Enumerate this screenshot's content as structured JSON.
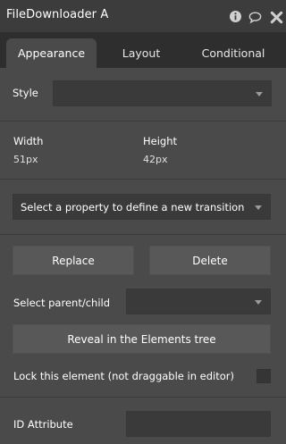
{
  "window": {
    "title": "FileDownloader A",
    "icons": [
      "info-icon",
      "comment-icon",
      "close-icon"
    ]
  },
  "tabs": [
    {
      "label": "Appearance",
      "active": true
    },
    {
      "label": "Layout",
      "active": false
    },
    {
      "label": "Conditional",
      "active": false
    }
  ],
  "style": {
    "label": "Style",
    "value": ""
  },
  "size": {
    "width_label": "Width",
    "width_value": "51px",
    "height_label": "Height",
    "height_value": "42px"
  },
  "transition": {
    "placeholder": "Select a property to define a new transition"
  },
  "actions": {
    "replace": "Replace",
    "delete": "Delete"
  },
  "parent_child": {
    "label": "Select parent/child",
    "value": ""
  },
  "reveal": {
    "label": "Reveal in the Elements tree"
  },
  "lock": {
    "label": "Lock this element (not draggable in editor)",
    "checked": false
  },
  "id_attribute": {
    "label": "ID Attribute",
    "value": ""
  },
  "colors": {
    "background": "#3c3c3c",
    "tab_bar": "#2e2e2e",
    "panel": "#4a4a4a",
    "input": "#3a3a3a",
    "button": "#585858"
  }
}
